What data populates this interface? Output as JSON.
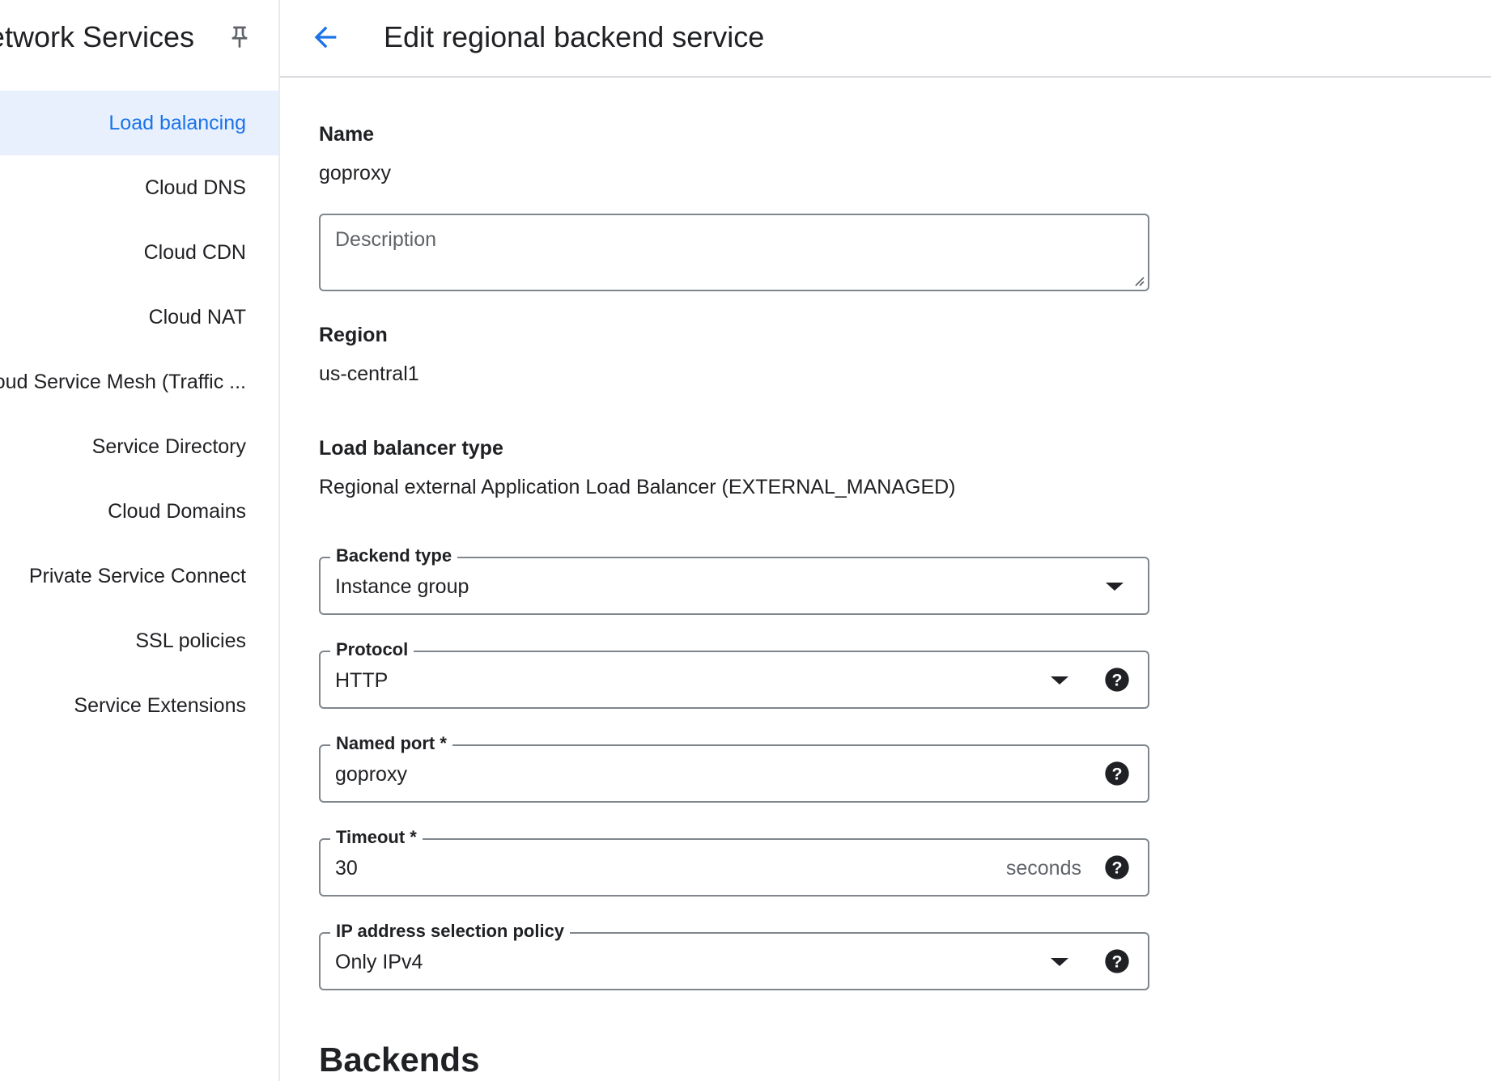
{
  "sidebar": {
    "title": "Network Services",
    "items": [
      {
        "label": "Load balancing",
        "active": true
      },
      {
        "label": "Cloud DNS"
      },
      {
        "label": "Cloud CDN"
      },
      {
        "label": "Cloud NAT"
      },
      {
        "label": "Cloud Service Mesh (Traffic ..."
      },
      {
        "label": "Service Directory"
      },
      {
        "label": "Cloud Domains"
      },
      {
        "label": "Private Service Connect"
      },
      {
        "label": "SSL policies"
      },
      {
        "label": "Service Extensions"
      }
    ]
  },
  "header": {
    "title": "Edit regional backend service"
  },
  "form": {
    "name_label": "Name",
    "name_value": "goproxy",
    "description_placeholder": "Description",
    "region_label": "Region",
    "region_value": "us-central1",
    "lb_type_label": "Load balancer type",
    "lb_type_value": "Regional external Application Load Balancer (EXTERNAL_MANAGED)",
    "backend_type": {
      "label": "Backend type",
      "value": "Instance group"
    },
    "protocol": {
      "label": "Protocol",
      "value": "HTTP"
    },
    "named_port": {
      "label": "Named port *",
      "value": "goproxy"
    },
    "timeout": {
      "label": "Timeout *",
      "value": "30",
      "suffix": "seconds"
    },
    "ip_policy": {
      "label": "IP address selection policy",
      "value": "Only IPv4"
    }
  },
  "backends_heading": "Backends",
  "colors": {
    "accent": "#1a73e8",
    "active_bg": "#e8f0fe",
    "border": "#80868b"
  }
}
